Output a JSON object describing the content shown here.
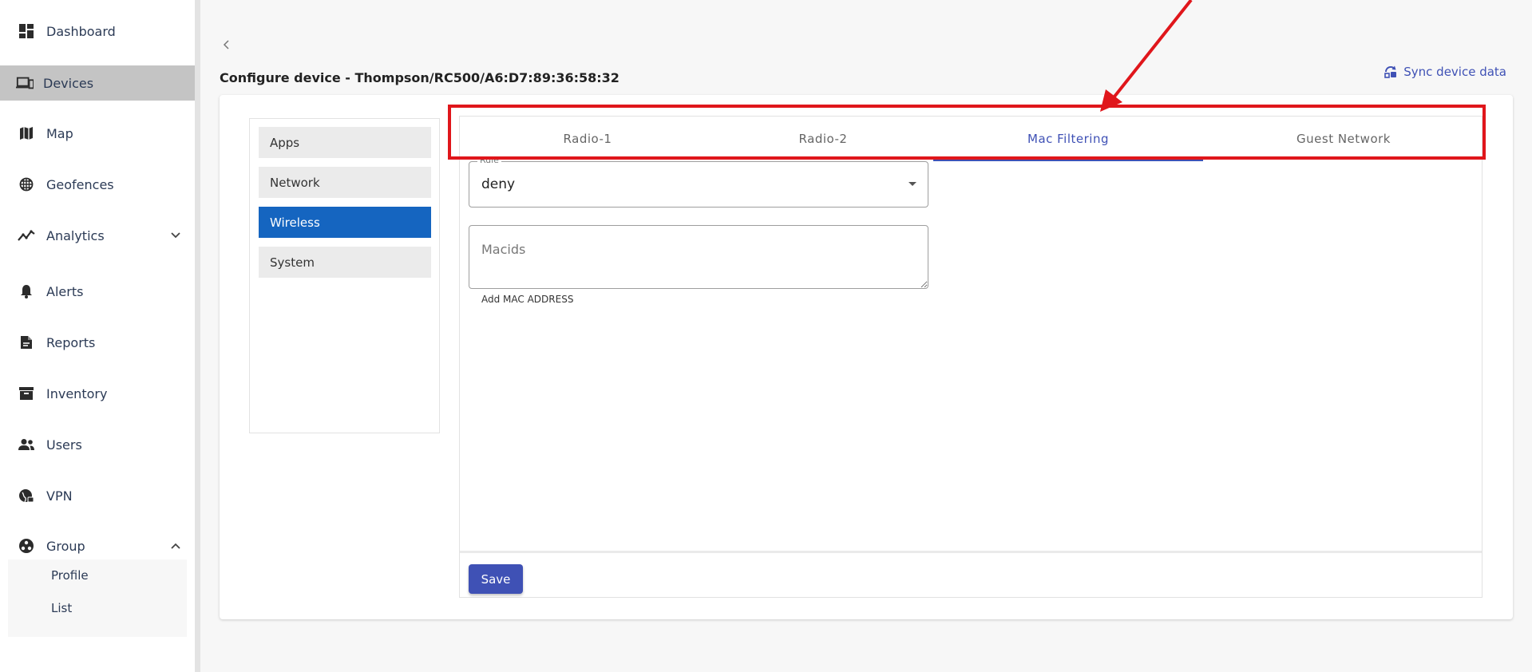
{
  "sidebar": {
    "items": [
      {
        "label": "Dashboard",
        "icon": "dashboard-icon"
      },
      {
        "label": "Devices",
        "icon": "devices-icon",
        "active": true
      },
      {
        "label": "Map",
        "icon": "map-icon"
      },
      {
        "label": "Geofences",
        "icon": "geofence-icon"
      },
      {
        "label": "Analytics",
        "icon": "analytics-icon",
        "expandable": true
      },
      {
        "label": "Alerts",
        "icon": "bell-icon"
      },
      {
        "label": "Reports",
        "icon": "report-icon"
      },
      {
        "label": "Inventory",
        "icon": "inventory-icon"
      },
      {
        "label": "Users",
        "icon": "users-icon"
      },
      {
        "label": "VPN",
        "icon": "vpn-icon"
      },
      {
        "label": "Group",
        "icon": "group-icon",
        "expanded": true
      }
    ],
    "group_children": [
      "Profile",
      "List"
    ]
  },
  "header": {
    "title": "Configure device - Thompson/RC500/A6:D7:89:36:58:32",
    "sync_label": "Sync device data"
  },
  "left_menu": {
    "items": [
      "Apps",
      "Network",
      "Wireless",
      "System"
    ],
    "active": "Wireless"
  },
  "tabs": {
    "items": [
      "Radio-1",
      "Radio-2",
      "Mac Filtering",
      "Guest Network"
    ],
    "active": "Mac Filtering"
  },
  "form": {
    "rule_label": "Rule",
    "rule_value": "deny",
    "macids_placeholder": "Macids",
    "helper_text": "Add MAC ADDRESS",
    "save_label": "Save"
  },
  "colors": {
    "accent": "#3f51b5",
    "active_menu": "#1565c0",
    "annotation": "#e0161b"
  }
}
